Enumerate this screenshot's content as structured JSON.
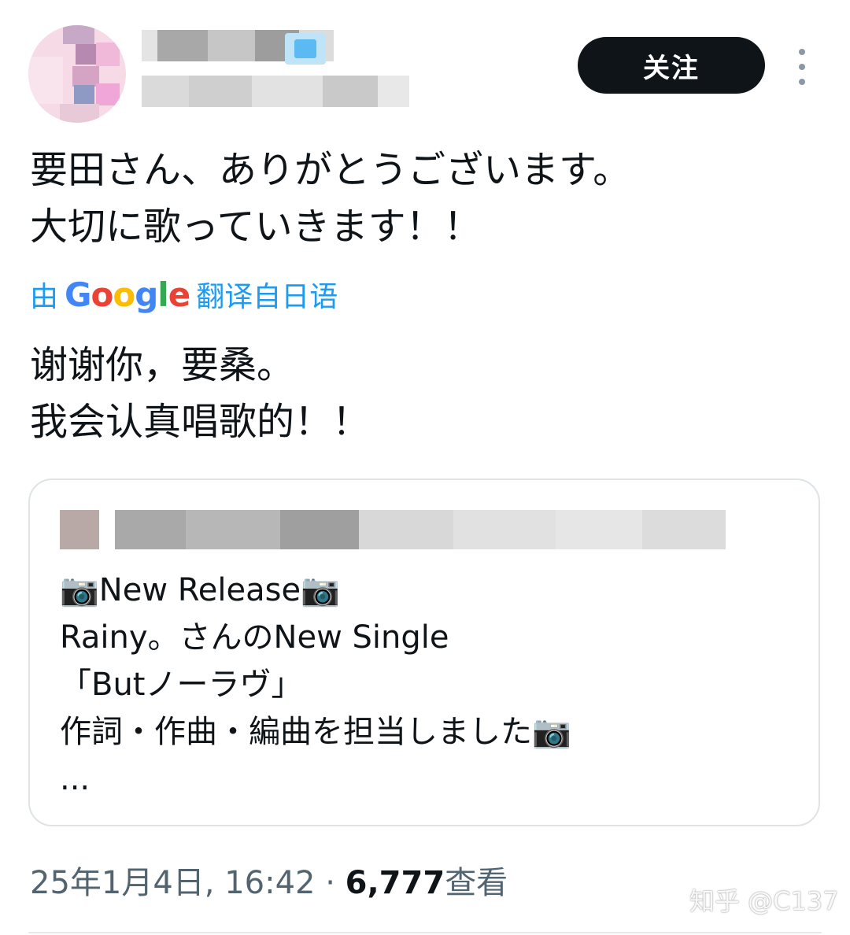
{
  "header": {
    "follow_label": "关注"
  },
  "tweet": {
    "original_lines": [
      "要田さん、ありがとうございます。",
      "大切に歌っていきます！！"
    ],
    "translation": {
      "prefix": "由",
      "provider": "Google",
      "suffix": "翻译自日语"
    },
    "translated_lines": [
      "谢谢你，要桑。",
      "我会认真唱歌的！！"
    ]
  },
  "quote": {
    "lines": [
      "📷New Release📷",
      "Rainy。さんのNew Single",
      "「Butノーラヴ」",
      "作詞・作曲・編曲を担当しました📷",
      "..."
    ]
  },
  "meta": {
    "timestamp": "25年1月4日, 16:42",
    "separator": "·",
    "view_count": "6,777",
    "view_label": "查看"
  },
  "watermark": "知乎 @C137",
  "colors": {
    "accent": "#1d9bf0",
    "text": "#0f1419",
    "muted": "#536471",
    "button_bg": "#0f1419",
    "google_blue": "#4285f4",
    "google_red": "#ea4335",
    "google_yellow": "#fbbc05",
    "google_green": "#34a853"
  },
  "icons": {
    "more": "more-vertical-icon",
    "camera": "camera-emoji"
  }
}
